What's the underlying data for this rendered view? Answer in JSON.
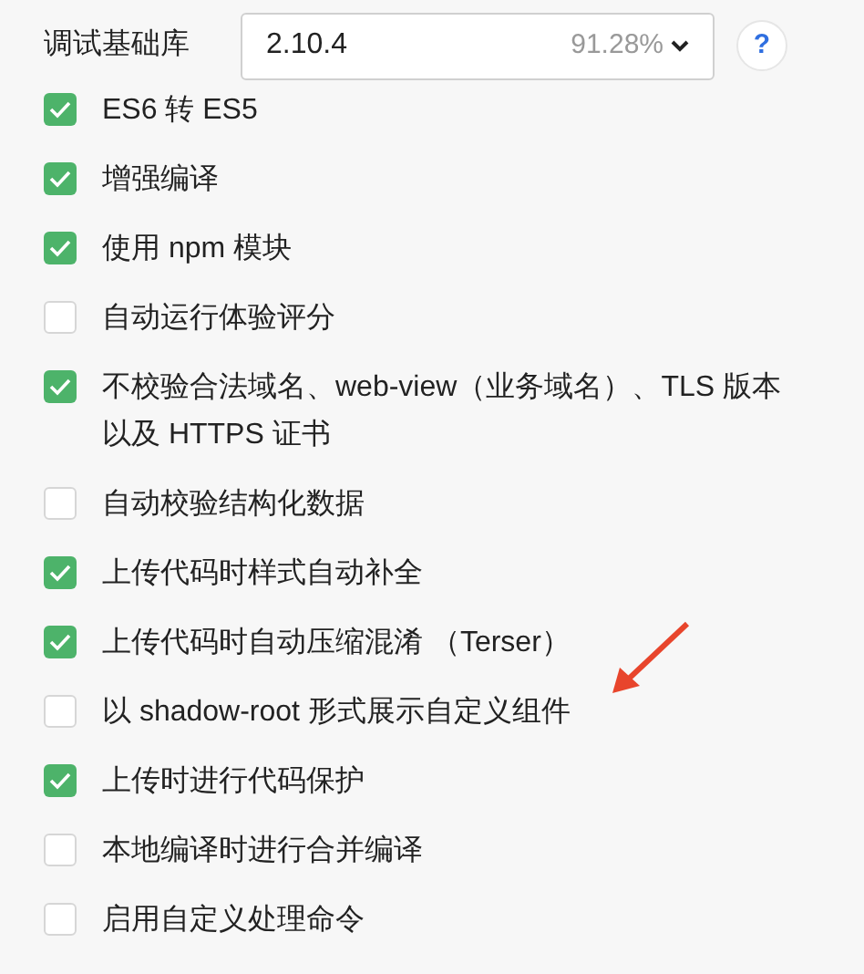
{
  "base_library": {
    "label": "调试基础库",
    "value": "2.10.4",
    "usage": "91.28%",
    "help": "?"
  },
  "options": [
    {
      "label": "ES6 转 ES5",
      "checked": true
    },
    {
      "label": "增强编译",
      "checked": true
    },
    {
      "label": "使用 npm 模块",
      "checked": true
    },
    {
      "label": "自动运行体验评分",
      "checked": false
    },
    {
      "label": "不校验合法域名、web-view（业务域名）、TLS 版本以及 HTTPS 证书",
      "checked": true
    },
    {
      "label": "自动校验结构化数据",
      "checked": false
    },
    {
      "label": "上传代码时样式自动补全",
      "checked": true
    },
    {
      "label": "上传代码时自动压缩混淆 （Terser）",
      "checked": true
    },
    {
      "label": "以 shadow-root 形式展示自定义组件",
      "checked": false
    },
    {
      "label": "上传时进行代码保护",
      "checked": true
    },
    {
      "label": "本地编译时进行合并编译",
      "checked": false
    },
    {
      "label": "启用自定义处理命令",
      "checked": false
    }
  ]
}
